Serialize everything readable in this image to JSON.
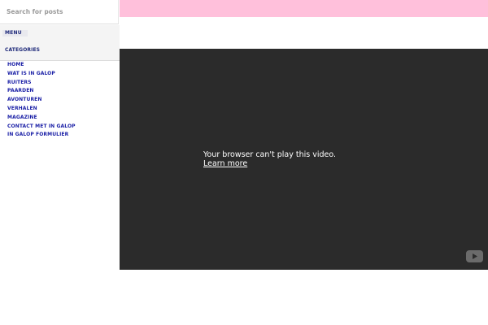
{
  "search": {
    "placeholder": "Search for posts"
  },
  "menu": {
    "toggle_label": "MENU",
    "categories_heading": "CATEGORIES",
    "items": [
      {
        "label": "HOME"
      },
      {
        "label": "WAT IS IN GALOP"
      },
      {
        "label": "RUITERS"
      },
      {
        "label": "PAARDEN"
      },
      {
        "label": "AVONTUREN"
      },
      {
        "label": "VERHALEN"
      },
      {
        "label": "MAGAZINE"
      },
      {
        "label": "CONTACT MET IN GALOP"
      },
      {
        "label": "IN GALOP FORMULIER"
      }
    ]
  },
  "video": {
    "message": "Your browser can't play this video.",
    "link_label": "Learn more",
    "brand_icon": "youtube-icon"
  },
  "colors": {
    "header_band": "#ffc0db",
    "video_background": "#2b2b2b",
    "nav_link": "#1a1fa6",
    "nav_heading": "#1f2a7a",
    "menu_panel": "#f4f4f4"
  }
}
